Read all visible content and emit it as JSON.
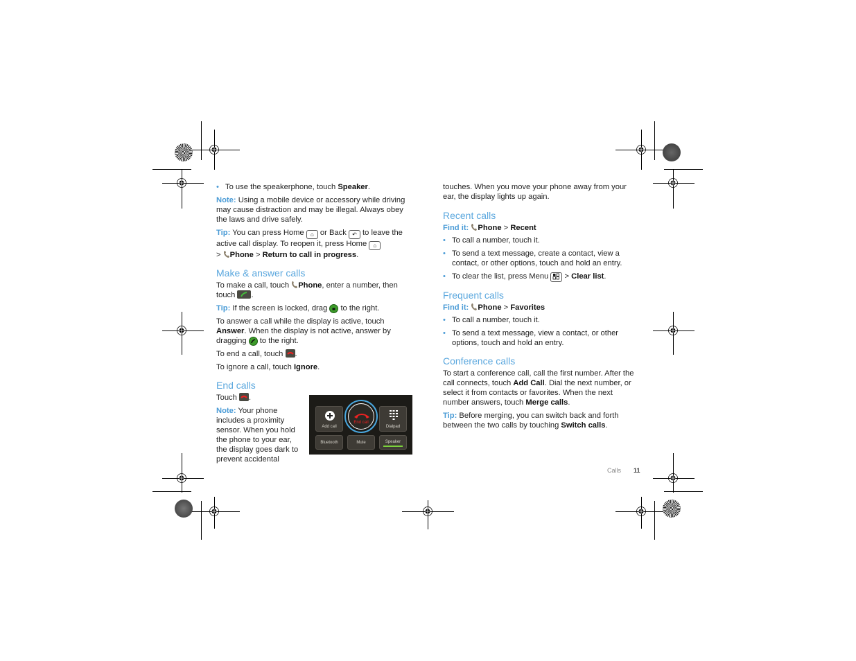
{
  "left_column": {
    "speaker_bullet": {
      "pre": "To use the speakerphone, touch ",
      "bold": "Speaker",
      "post": "."
    },
    "note1": {
      "label": "Note:",
      "text": " Using a mobile device or accessory while driving may cause distraction and may be illegal. Always obey the laws and drive safely."
    },
    "tip1": {
      "label": "Tip:",
      "t1": " You can press Home ",
      "t2": " or Back ",
      "t3": " to leave the active call display. To reopen it, press Home ",
      "t4": " > ",
      "phone": "Phone",
      "sep": " > ",
      "bold2": "Return to call in progress",
      "end": "."
    },
    "make_answer": {
      "heading": "Make & answer calls",
      "p1": {
        "t1": "To make a call, touch ",
        "bold": "Phone",
        "t2": ", enter a number, then touch ",
        "end": "."
      },
      "tip": {
        "label": "Tip:",
        "t1": " If the screen is locked, drag ",
        "t2": " to the right."
      },
      "p2": {
        "t1": "To answer a call while the display is active, touch ",
        "bold": "Answer",
        "t2": ". When the display is not active, answer by dragging ",
        "t3": " to the right."
      },
      "p3": {
        "t1": "To end a call, touch ",
        "end": "."
      },
      "p4": {
        "t1": "To ignore a call, touch ",
        "bold": "Ignore",
        "end": "."
      }
    },
    "end_calls": {
      "heading": "End calls",
      "p1": {
        "t1": "Touch ",
        "end": "."
      },
      "note": {
        "label": "Note:",
        "text": " Your phone includes a proximity sensor. When you hold the phone to your ear, the display goes dark to prevent accidental"
      }
    }
  },
  "phone_screen": {
    "add_call": "Add call",
    "end_call": "End call",
    "dialpad": "Dialpad",
    "bluetooth": "Bluetooth",
    "mute": "Mute",
    "speaker": "Speaker"
  },
  "right_column": {
    "continued": "touches. When you move your phone away from your ear, the display lights up again.",
    "recent": {
      "heading": "Recent calls",
      "find_label": "Find it:",
      "phone": "Phone",
      "sep": " > ",
      "dest": "Recent",
      "bullets": [
        "To call a number, touch it.",
        "To send a text message, create a contact, view a contact, or other options, touch and hold an entry."
      ],
      "clear": {
        "t1": "To clear the list, press Menu ",
        "t2": " > ",
        "bold": "Clear list",
        "end": "."
      }
    },
    "frequent": {
      "heading": "Frequent calls",
      "find_label": "Find it:",
      "phone": "Phone",
      "sep": " > ",
      "dest": "Favorites",
      "bullets": [
        "To call a number, touch it.",
        "To send a text message, view a contact, or other options, touch and hold an entry."
      ]
    },
    "conference": {
      "heading": "Conference calls",
      "p1": {
        "t1": "To start a conference call, call the first number. After the call connects, touch ",
        "b1": "Add Call",
        "t2": ". Dial the next number, or select it from contacts or favorites. When the next number answers, touch ",
        "b2": "Merge calls",
        "end": "."
      },
      "tip": {
        "label": "Tip:",
        "t1": " Before merging, you can switch back and forth between the two calls by touching ",
        "bold": "Switch calls",
        "end": "."
      }
    }
  },
  "footer": {
    "section": "Calls",
    "page_number": "11"
  },
  "colors": {
    "accent": "#4a9bd6",
    "heading": "#5aa7de",
    "end_call_red": "#e22222",
    "answer_green": "#3d9b2a"
  }
}
